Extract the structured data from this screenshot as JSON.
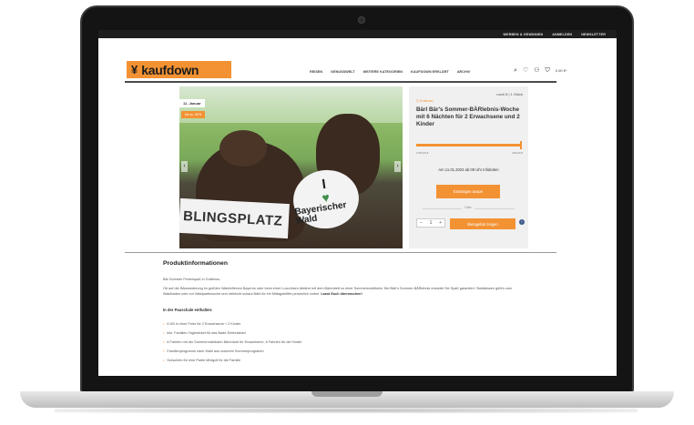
{
  "topbar": {
    "gift": "WERBEN & GEWINNEN",
    "login": "ANMELDEN",
    "newsletter": "NEWSLETTER"
  },
  "logo": {
    "text": "kaufdown"
  },
  "nav": [
    "REISEN",
    "GENUSSWELT",
    "WEITERE KATEGORIEN",
    "KAUFDOWN ERKLÄRT",
    "ARCHIV"
  ],
  "header_icons": [
    "search-icon",
    "heart-icon",
    "user-icon",
    "cart-icon"
  ],
  "cart_total": "0,00 €*",
  "hero": {
    "date": "11. Januar",
    "badge": "bis zu -50%",
    "sign": "BLINGSPLATZ",
    "ball_i": "I",
    "ball_heart": "♥",
    "ball_text": "Bayerischer Wald"
  },
  "offer": {
    "stock": "noch 8 | 1 Stück",
    "location": "Grafenau",
    "title": "Bärl Bär's Sommer-BÄRlebnis-Woche mit 6 Nächten für 2 Erwachsene und 2 Kinder",
    "progress": 1.0,
    "price_start": "1790,00 €",
    "price_end": "939,00 €",
    "end_note": "Am 11.01.2023 ab 09 Uhr Infoboten",
    "main_button": "Einsteigen auspe",
    "or": "Oder",
    "qty": "1",
    "cart_button": "Bietagebot zeigen"
  },
  "content": {
    "heading": "Produktinformationen",
    "line1": "Bär Sommer Ferienspaß in Grafenau",
    "para": "Ob auf der Bärwanderung im größten Waldreflexion Bayerns oder beim einer Luxuriösen Abfahrt mit dem Bärenbett zu einer Sommerrodelbahn. Bei Bärl's Sommer-BÄRlebnis erwartet Sie Spaß garantiert. Stattdessen geht's zum Waldbaden oder zur Waldpartiesuche und vielleicht schaut Bärli für ein Mittagsbüffet persönlich vorbei.",
    "para_bold": "Lasst Euch überraschen!",
    "sub": "In der Pauschale enthalten:",
    "items": [
      "6 ÜN in einer Feier für 2 Erwachsene + 2 Kinder",
      "inkl. Familien-Tagesticket für das Bade-Erlebnisbad",
      "6 Fahrten mit der Sommerrodelbahn Bärenbob für Erwachsene, 6 Fahrten für die Kinder",
      "Familienprogramm nach Wahl aus unserem Sommerprogramm",
      "Gutschein für eine Partie Minigolf für die Familie"
    ]
  }
}
